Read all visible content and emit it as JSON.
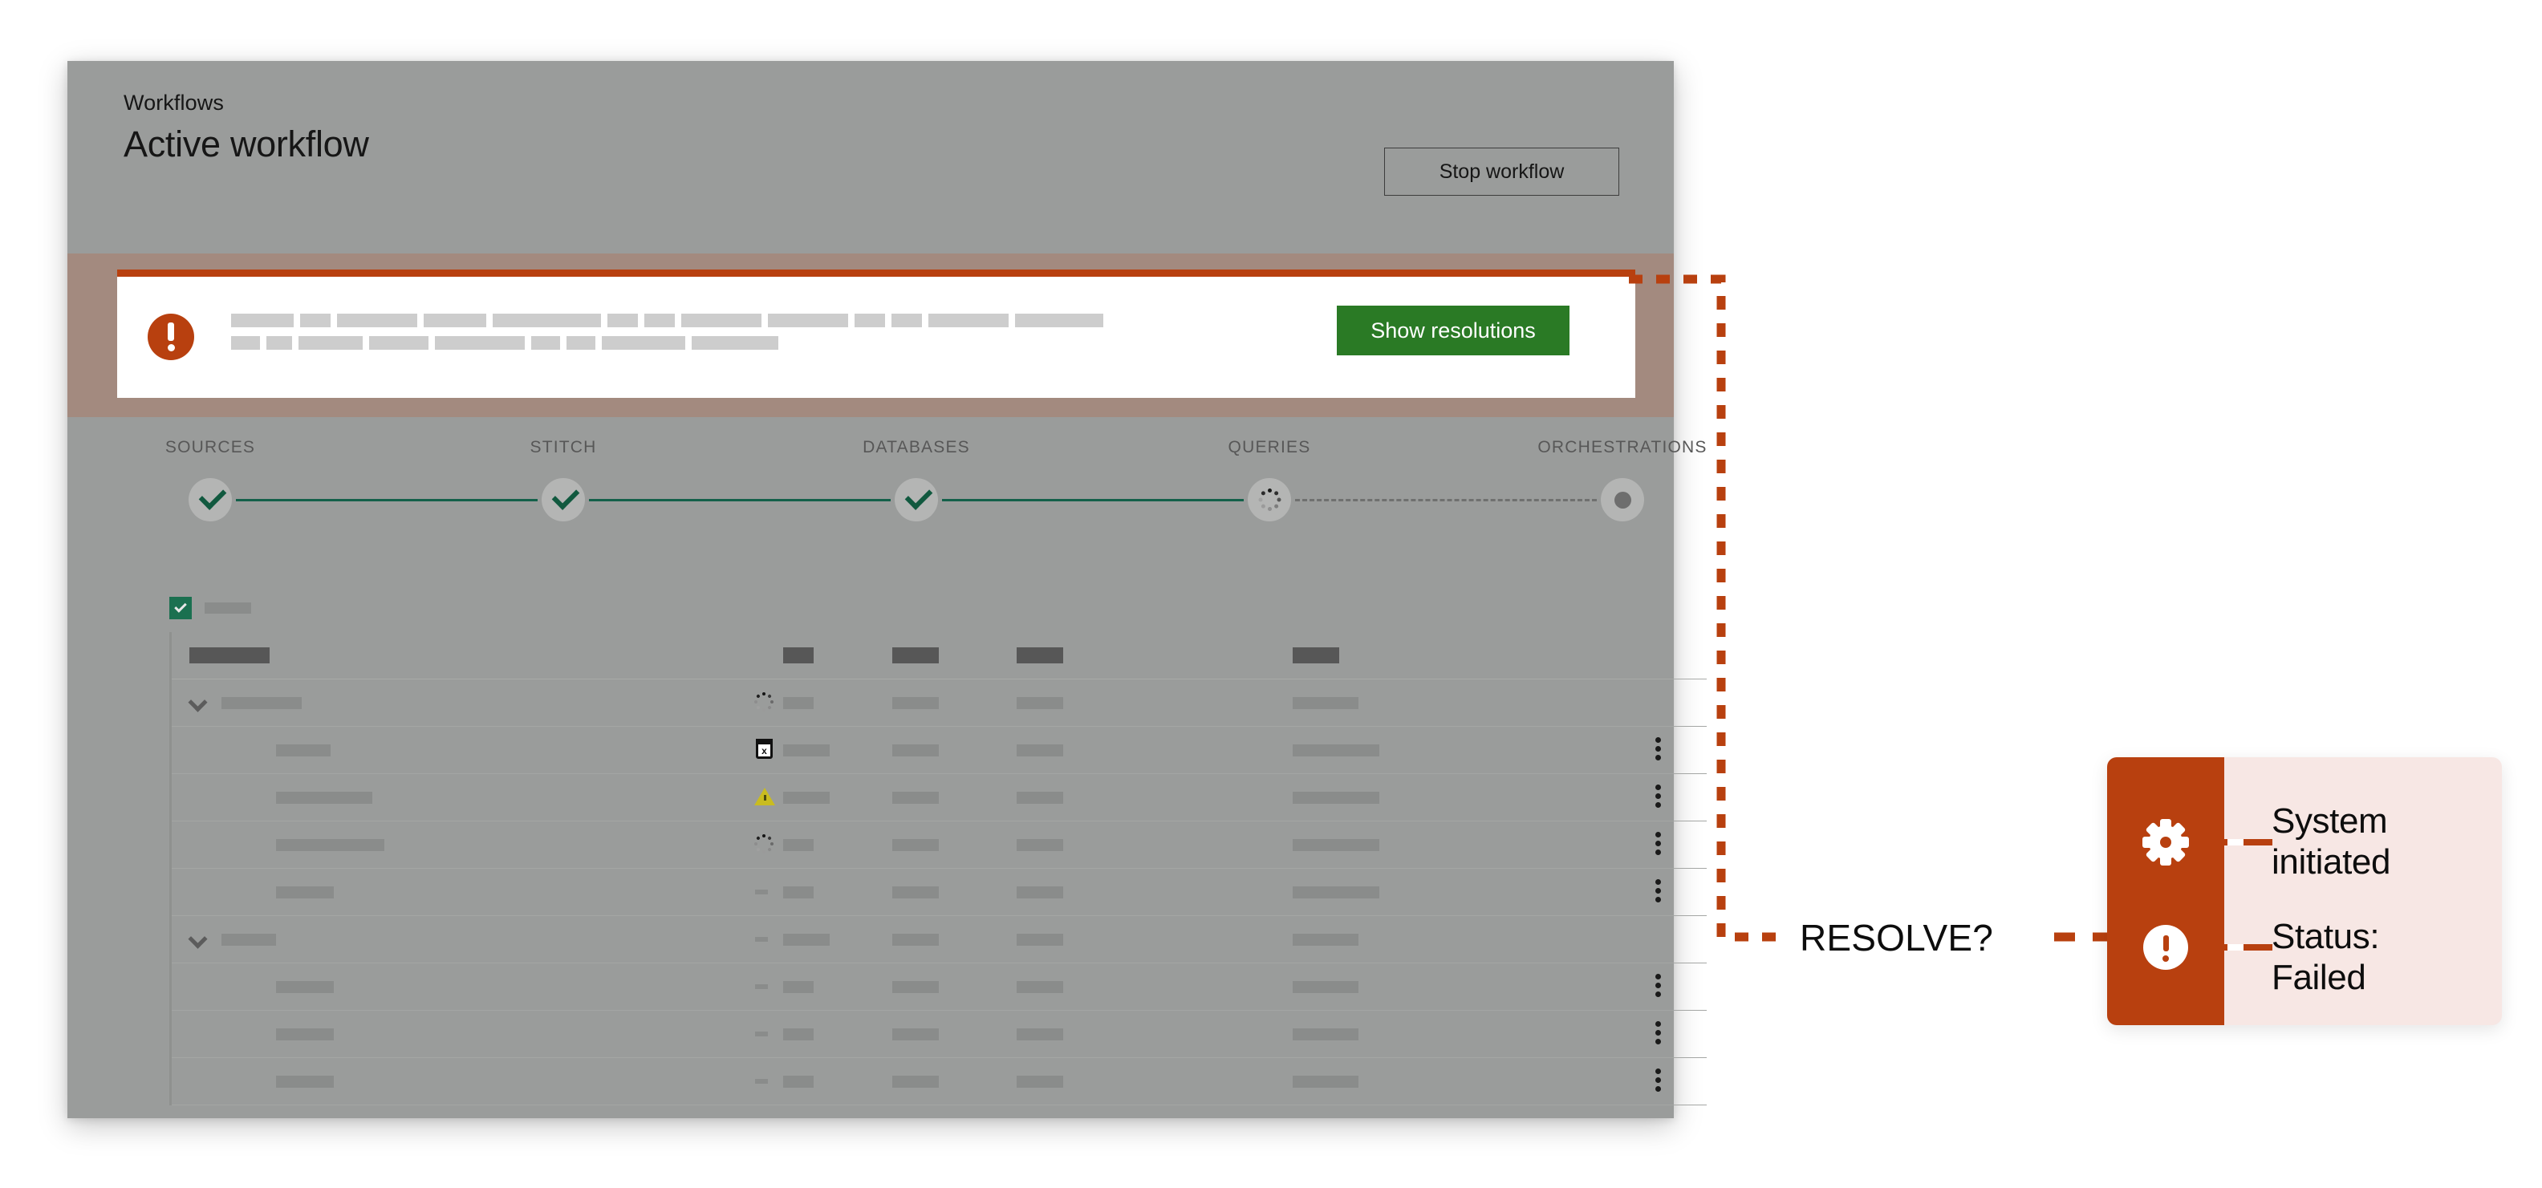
{
  "window": {
    "breadcrumb": "Workflows",
    "title": "Active workflow",
    "stop_button": "Stop workflow"
  },
  "alert": {
    "icon": "error-exclamation-icon",
    "accent_color": "#b8400f",
    "band_color": "#a38a7f",
    "button_label": "Show resolutions",
    "button_color": "#2a7a25",
    "line1_bars": [
      78,
      38,
      100,
      78,
      135,
      38,
      38,
      100,
      100,
      38,
      38,
      100,
      110
    ],
    "line2_bars": [
      36,
      32,
      80,
      74,
      112,
      36,
      36,
      104,
      108
    ]
  },
  "stepper": {
    "steps": [
      {
        "label": "SOURCES",
        "state": "complete",
        "icon": "check-icon"
      },
      {
        "label": "STITCH",
        "state": "complete",
        "icon": "check-icon"
      },
      {
        "label": "DATABASES",
        "state": "complete",
        "icon": "check-icon"
      },
      {
        "label": "QUERIES",
        "state": "running",
        "icon": "spinner-icon"
      },
      {
        "label": "ORCHESTRATIONS",
        "state": "pending",
        "icon": "dot-icon"
      }
    ],
    "complete_color": "#11593f",
    "connector_solid_color": "#14604a",
    "connector_dashed_color": "#6f706f"
  },
  "table": {
    "select_all_checked": true,
    "checkbox_color": "#1b7050",
    "select_all_bar": 58,
    "header": {
      "bars": [
        100,
        38,
        58,
        58,
        58
      ]
    },
    "rows": [
      {
        "type": "group",
        "indent": 62,
        "chevron": true,
        "status_icon": "spinner-icon",
        "bars": [
          100,
          38,
          58,
          58,
          82
        ],
        "kebab": false
      },
      {
        "type": "child",
        "indent": 130,
        "chevron": false,
        "status_icon": "calendar-x-icon",
        "bars": [
          68,
          58,
          58,
          58,
          108
        ],
        "kebab": true
      },
      {
        "type": "child",
        "indent": 130,
        "chevron": false,
        "status_icon": "warning-icon",
        "bars": [
          120,
          58,
          58,
          58,
          108
        ],
        "kebab": true
      },
      {
        "type": "child",
        "indent": 130,
        "chevron": false,
        "status_icon": "spinner-icon",
        "bars": [
          135,
          38,
          58,
          58,
          108
        ],
        "kebab": true
      },
      {
        "type": "child",
        "indent": 130,
        "chevron": false,
        "status_icon": "dash-icon",
        "bars": [
          72,
          38,
          58,
          58,
          108
        ],
        "kebab": true
      },
      {
        "type": "group",
        "indent": 62,
        "chevron": true,
        "status_icon": "dash-icon",
        "bars": [
          68,
          58,
          58,
          58,
          82
        ],
        "kebab": false
      },
      {
        "type": "child",
        "indent": 130,
        "chevron": false,
        "status_icon": "dash-icon",
        "bars": [
          72,
          38,
          58,
          58,
          82
        ],
        "kebab": true
      },
      {
        "type": "child",
        "indent": 130,
        "chevron": false,
        "status_icon": "dash-icon",
        "bars": [
          72,
          38,
          58,
          58,
          82
        ],
        "kebab": true
      },
      {
        "type": "child",
        "indent": 130,
        "chevron": false,
        "status_icon": "dash-icon",
        "bars": [
          72,
          38,
          58,
          58,
          82
        ],
        "kebab": true
      }
    ]
  },
  "annotation": {
    "resolve_label": "RESOLVE?",
    "connector_color": "#b8400f",
    "card": {
      "rail_color": "#b8400f",
      "panel_color": "#f7e7e4",
      "items": [
        {
          "icon": "gear-icon",
          "line1": "System",
          "line2": "initiated"
        },
        {
          "icon": "exclamation-icon",
          "line1": "Status:",
          "line2": "Failed"
        }
      ]
    }
  }
}
